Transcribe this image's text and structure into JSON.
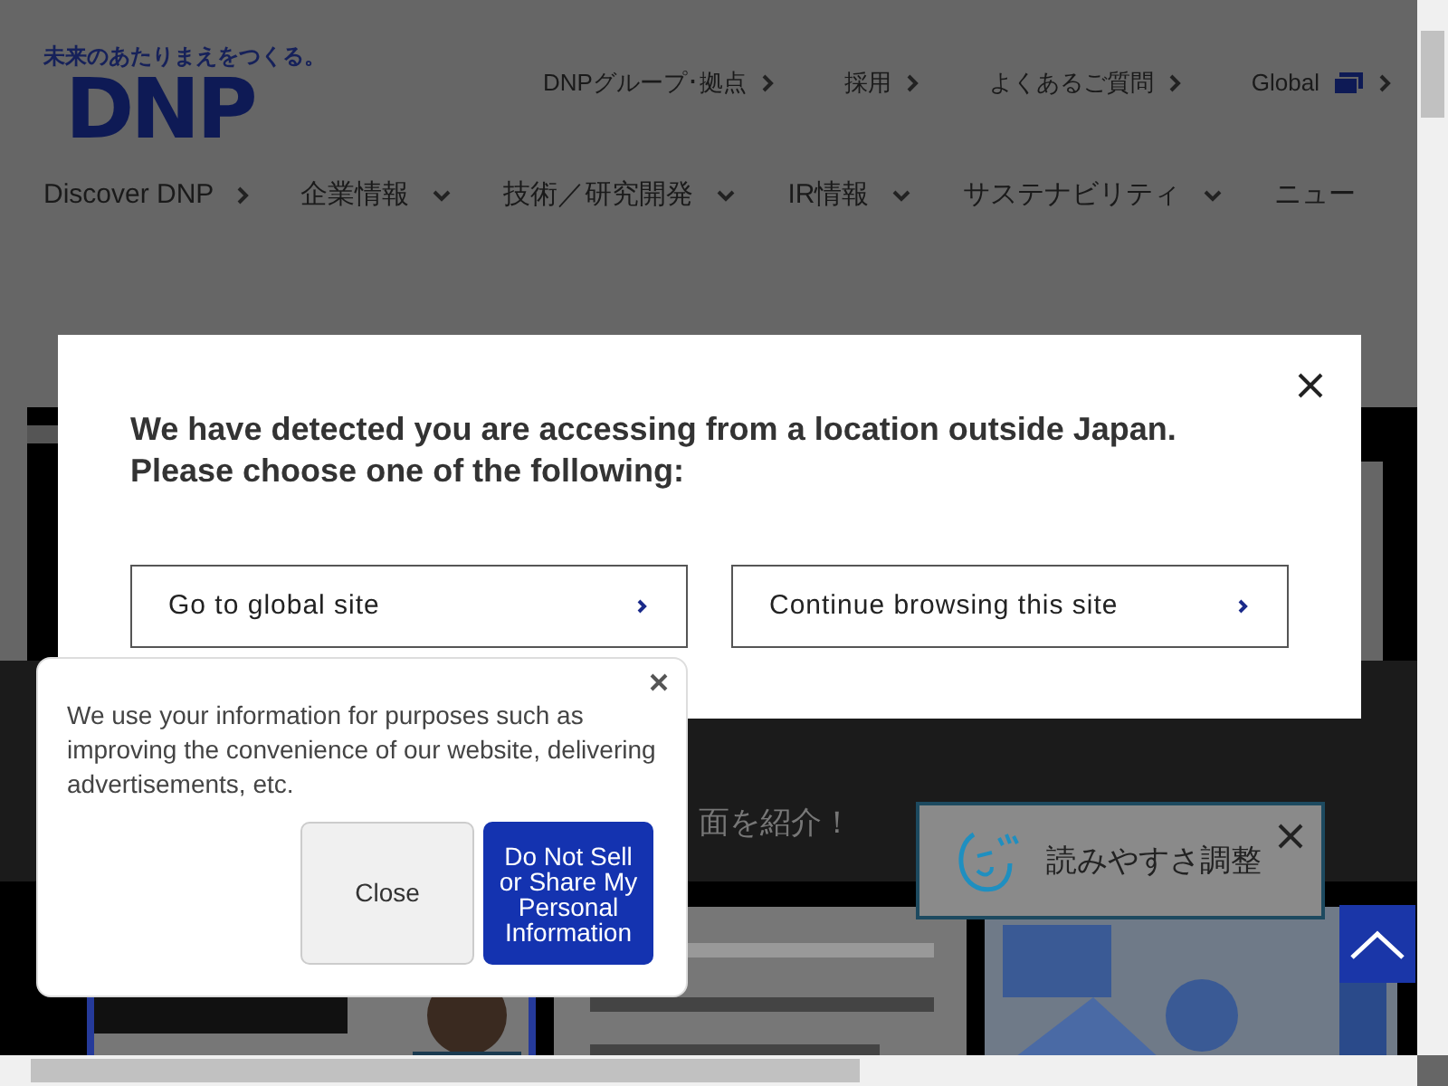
{
  "header": {
    "tagline": "未来のあたりまえをつくる。",
    "logo": "DNP",
    "utility_links": [
      {
        "label": "DNPグループ･拠点",
        "kind": "link"
      },
      {
        "label": "採用",
        "kind": "link"
      },
      {
        "label": "よくあるご質問",
        "kind": "link"
      },
      {
        "label": "Global",
        "kind": "global"
      }
    ],
    "nav": [
      {
        "label": "Discover DNP",
        "kind": "link"
      },
      {
        "label": "企業情報",
        "kind": "menu"
      },
      {
        "label": "技術／研究開発",
        "kind": "menu"
      },
      {
        "label": "IR情報",
        "kind": "menu"
      },
      {
        "label": "サステナビリティ",
        "kind": "menu"
      },
      {
        "label": "ニュー",
        "kind": "plain"
      }
    ]
  },
  "section_text": "面を紹介！",
  "location_modal": {
    "message": "We have detected you are accessing from a location outside Japan.\nPlease choose one of the following:",
    "buttons": [
      "Go to global site",
      "Continue browsing this site"
    ]
  },
  "cookie_notice": {
    "message": "We use your information for purposes such as improving the convenience of our website, delivering advertisements, etc.",
    "buttons": [
      {
        "label": "Close",
        "kind": "secondary"
      },
      {
        "label": "Do Not Sell or Share My Personal Information",
        "kind": "primary"
      }
    ]
  },
  "accessibility_widget": {
    "label": "読みやすさ調整"
  }
}
